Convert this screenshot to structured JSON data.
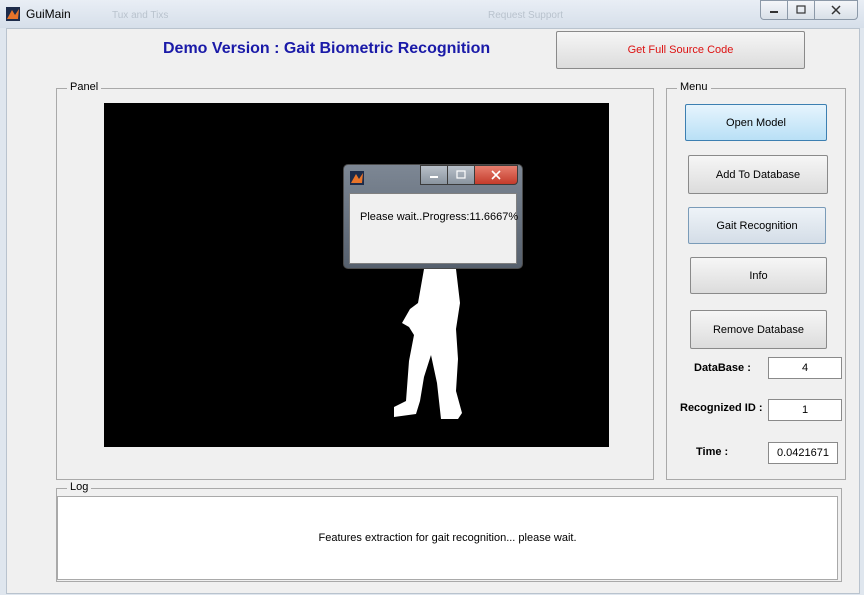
{
  "window": {
    "title": "GuiMain"
  },
  "toolbar_ghost": [
    "Tux and Tixs",
    "Request Support"
  ],
  "header": {
    "title": "Demo Version : Gait Biometric Recognition",
    "source_button": "Get Full Source Code"
  },
  "panel": {
    "legend": "Panel"
  },
  "menu": {
    "legend": "Menu",
    "buttons": [
      "Open Model",
      "Add To Database",
      "Gait Recognition",
      "Info",
      "Remove Database"
    ],
    "database_label": "DataBase :",
    "database_value": "4",
    "recognized_label": "Recognized  ID :",
    "recognized_value": "1",
    "time_label": "Time :",
    "time_value": "0.0421671"
  },
  "log": {
    "legend": "Log",
    "message": "Features extraction for gait recognition... please wait."
  },
  "dialog": {
    "message": "Please wait..Progress:11.6667%",
    "progress_percent": 11.6667
  },
  "colors": {
    "heading": "#1a1aa8",
    "source_text": "#dd1111",
    "axes_bg": "#000000"
  }
}
